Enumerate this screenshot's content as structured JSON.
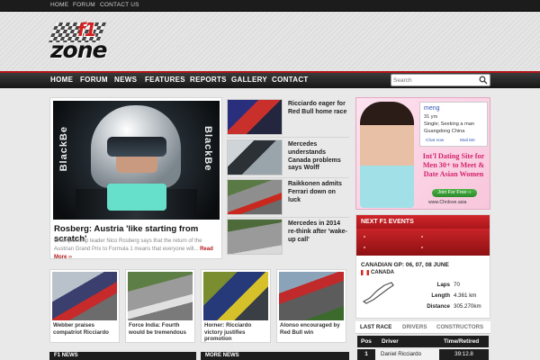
{
  "topbar": {
    "links": [
      "HOME",
      "FORUM",
      "CONTACT US"
    ]
  },
  "logo": {
    "f1": "f1",
    "zone": "zone"
  },
  "nav": {
    "items": [
      "HOME",
      "FORUM",
      "NEWS",
      "FEATURES",
      "REPORTS",
      "GALLERY",
      "CONTACT"
    ]
  },
  "search": {
    "placeholder": "Search"
  },
  "feature": {
    "side_text_left": "BlackBe",
    "side_text_right": "BlackBe",
    "title": "Rosberg: Austria 'like starting from scratch'",
    "text": "Championship leader Nico Rosberg says that the return of the Austrian Grand Prix to Formula 1 means that everyone will...",
    "more": "Read More ››"
  },
  "side_stories": [
    {
      "title": "Ricciardo eager for Red Bull home race"
    },
    {
      "title": "Mercedes understands Canada problems says Wolff"
    },
    {
      "title": "Raikkonen admits Ferrari down on luck"
    },
    {
      "title": "Mercedes in 2014 re-think after 'wake-up call'"
    }
  ],
  "ad": {
    "name": "meng",
    "age": "31 yrs",
    "status": "Single; Seeking a man",
    "location": "Guangdong China",
    "chat": "Chat now",
    "mail": "Mail Me",
    "headline": "Int'l Dating Site for Men 30+ to Meet & Date Asian Women",
    "follow": "Join For Free ››",
    "url": "www.Chnlove.asia"
  },
  "events": {
    "header": "NEXT F1 EVENTS",
    "race": "CANADIAN GP: 06, 07, 08 JUNE",
    "country": "CANADA",
    "stats": [
      {
        "label": "Laps",
        "value": "70"
      },
      {
        "label": "Length",
        "value": "4.361 km"
      },
      {
        "label": "Distance",
        "value": "305.270km"
      }
    ]
  },
  "tabs": [
    "LAST RACE",
    "DRIVERS",
    "CONSTRUCTORS"
  ],
  "results": {
    "headers": [
      "Pos",
      "Driver",
      "Time/Retired"
    ],
    "rows": [
      {
        "pos": "1",
        "driver": "Daniel Ricciardo",
        "time": "39:12.8"
      }
    ]
  },
  "grid_stories": [
    {
      "title": "Webber praises compatriot Ricciardo"
    },
    {
      "title": "Force India: Fourth would be tremendous"
    },
    {
      "title": "Horner: Ricciardo victory justifies promotion"
    },
    {
      "title": "Alonso encouraged by Red Bull win"
    }
  ],
  "bottom_bars": [
    "F1 NEWS",
    "MORE NEWS"
  ],
  "colors": {
    "accent": "#b4171b",
    "nav": "#1e1e1e"
  }
}
